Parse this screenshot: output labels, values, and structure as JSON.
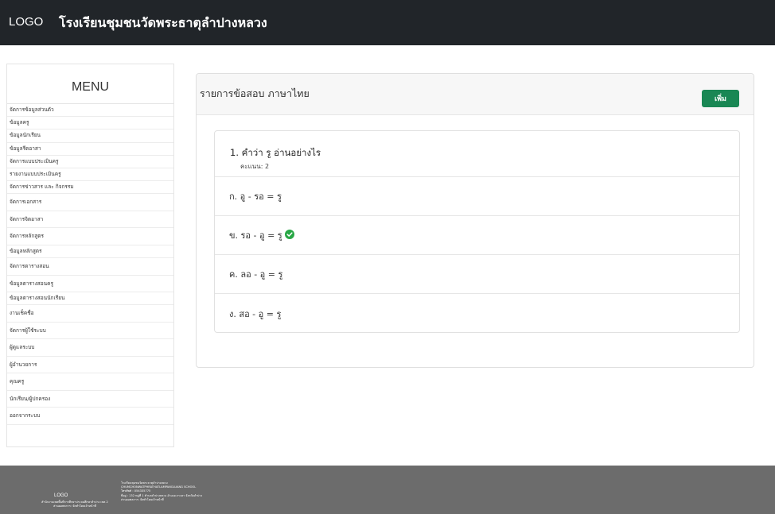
{
  "navbar": {
    "logo": "LOGO",
    "school_name": "โรงเรียนชุมชนวัดพระธาตุลำปางหลวง"
  },
  "sidebar": {
    "title": "MENU",
    "items": [
      "จัดการข้อมูลส่วนตัว",
      "ข้อมูลครู",
      "ข้อมูลนักเรียน",
      "ข้อมูลรีดอาสา",
      "จัดการแบบประเมินครู",
      "รายงานแบบประเมินครู",
      "จัดการข่าวสาร และ กิจกรรม",
      "จัดการเอกสาร",
      "จัดการจิตอาสา",
      "จัดการหลักสูตร",
      "ข้อมูลหลักสูตร",
      "จัดการตารางสอน",
      "ข้อมูลตารางสอนครู",
      "ข้อมูลตารางสอนนักเรียน",
      "งานเช็คชื่อ",
      "จัดการผู้ใช้ระบบ",
      "ผู้ดูแลระบบ",
      "ผู้อำนวยการ",
      "คุณครู",
      "นักเรียน/ผู้ปกครอง",
      "ออกจากระบบ"
    ]
  },
  "card": {
    "title": "รายการข้อสอบ ภาษาไทย",
    "add_button": "เพิ่ม"
  },
  "question": {
    "text": "1. คำว่า รู อ่านอย่างไร",
    "score": "คะแนน: 2",
    "choices": [
      {
        "text": "ก. อู - รอ = รู",
        "correct": false
      },
      {
        "text": "ข. รอ - อู = รู",
        "correct": true
      },
      {
        "text": "ค. ลอ - อู = รู",
        "correct": false
      },
      {
        "text": "ง. สอ - อู = รู",
        "correct": false
      }
    ],
    "correct_icon": "check-circle-icon",
    "correct_color": "#28a745"
  },
  "footer": {
    "logo": "LOGO",
    "office_line1": "สำนักงานเขตพื้นที่การศึกษาประถมศึกษาลำปาง เขต 2",
    "office_line2": "ส่วนผอพลการ: จัดทำโดยเจ้าหน้าที่",
    "school_th": "โรงเรียนชุมชนวัดพระธาตุลำปางหลวง",
    "school_en": "CHUMCHONWATPHRATHATLAMPANGLUANG SCHOOL",
    "phone": "โทรศัพท์ : 054335775",
    "address": "ที่อยู่ : 132 หมู่ที่ 1 ตำบลลำปางหลวง อำเภอเกาะคา จังหวัดลำปาง",
    "credit": "ส่วนผอพลการ: จัดทำโดยเจ้าหน้าที่"
  },
  "colors": {
    "navbar": "#212529",
    "add_button": "#198754",
    "footer": "#6c6c6c"
  }
}
